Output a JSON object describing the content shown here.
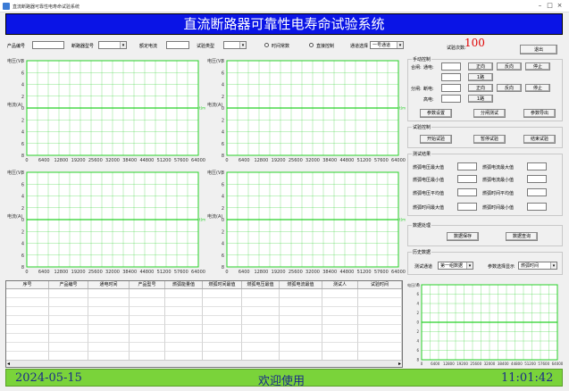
{
  "window": {
    "title": "直流断路器可靠性电寿命试验系统",
    "controls": [
      "–",
      "□",
      "×"
    ]
  },
  "banner": {
    "title": "直流断路器可靠性电寿命试验系统"
  },
  "params": {
    "product_no_label": "产品编号",
    "breaker_type_label": "断路器型号",
    "rated_current_label": "额定电流",
    "test_type_label": "试验类型",
    "radio_a_label": "时间常数",
    "radio_b_label": "直接控制",
    "channel_label": "通道选择",
    "channel_value": "一号通道",
    "count_label": "试验次数:",
    "count_value": "100",
    "exit_label": "退出"
  },
  "charts": {
    "y_ticks": [
      "8",
      "6",
      "4",
      "2",
      "0",
      "2",
      "4",
      "6",
      "8"
    ],
    "x_ticks": [
      "0",
      "6400",
      "12800",
      "19200",
      "25600",
      "32000",
      "38400",
      "44800",
      "51200",
      "57600",
      "64000"
    ],
    "grid_color": "#27d027",
    "ch1_top": "电压(V)",
    "ch1_mid": "电流(A)",
    "ch2_top": "电压(V)",
    "ch2_mid": "电流(A)",
    "ch3_top": "电压(V)",
    "ch3_mid": "电流(A)",
    "ch4_top": "电压(V)",
    "ch4_mid": "电流(A)",
    "t_unit": "t(ms)"
  },
  "mini_chart": {
    "y_ticks": [
      "8",
      "6",
      "4",
      "2",
      "0",
      "2",
      "4",
      "6",
      "8"
    ],
    "x_ticks": [
      "0",
      "6400",
      "12800",
      "19200",
      "25600",
      "32000",
      "38400",
      "44800",
      "51200",
      "57600",
      "64000"
    ],
    "top_label": "电压(V)"
  },
  "panel_control": {
    "title": "手动控制",
    "row1_label": "合闸:",
    "row1_sub": "通电:",
    "row1_b1": "正向",
    "row1_b2": "反向",
    "row1_b3": "停止",
    "row1_lock": "1路",
    "row2_label": "分闸:",
    "row2_sub": "断电:",
    "row2_b1": "正向",
    "row2_b2": "反向",
    "row2_b3": "停止",
    "row2_lock": "1路",
    "row3_sub": "高电:",
    "row4_sub": "高电:",
    "act_a": "参数设置",
    "act_b": "分闸测试",
    "act_c": "参数导出"
  },
  "panel_test": {
    "title": "试验控制",
    "b1": "开始试验",
    "b2": "暂停试验",
    "b3": "结束试验"
  },
  "panel_results": {
    "title": "测试结果",
    "l1": "燃弧电压最大值",
    "r1": "燃弧电流最大值",
    "l2": "燃弧电压最小值",
    "r2": "燃弧电流最小值",
    "l3": "燃弧电压平均值",
    "r3": "燃弧时间平均值",
    "l4": "燃弧时间最大值",
    "r4": "燃弧时间最小值"
  },
  "panel_data": {
    "title": "数据处理",
    "b1": "数据保存",
    "b2": "数据查询"
  },
  "panel_query": {
    "title": "历史数据",
    "sel1_label": "测试通道",
    "sel1_value": "第一组数据",
    "sel2_label": "参数选择显示",
    "sel2_value": "燃弧时间"
  },
  "table": {
    "columns": [
      "序号",
      "产品编号",
      "通电时间",
      "产品型号",
      "燃弧能量值",
      "燃弧时间最值",
      "燃弧电压最值",
      "燃弧电流最值",
      "测试人",
      "试验时间"
    ]
  },
  "status": {
    "date": "2024-05-15",
    "welcome": "欢迎使用",
    "time": "11:01:42"
  }
}
